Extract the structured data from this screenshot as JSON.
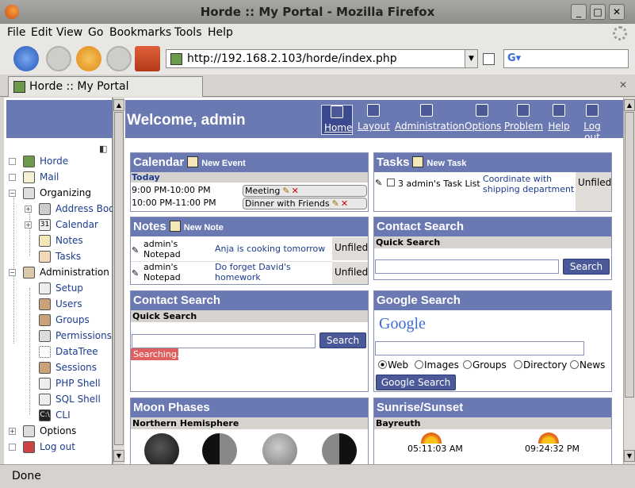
{
  "window": {
    "title": "Horde :: My Portal - Mozilla Firefox"
  },
  "menu": [
    "File",
    "Edit",
    "View",
    "Go",
    "Bookmarks",
    "Tools",
    "Help"
  ],
  "nav": {
    "url": "http://192.168.2.103/horde/index.php"
  },
  "tab": {
    "label": "Horde :: My Portal"
  },
  "sidebar": {
    "items": [
      {
        "label": "Horde",
        "icon": "horde-icon"
      },
      {
        "label": "Mail",
        "icon": "mail-icon"
      },
      {
        "label": "Organizing",
        "icon": "organizing-icon"
      },
      {
        "label": "Address Book",
        "icon": "address-book-icon"
      },
      {
        "label": "Calendar",
        "icon": "calendar-icon"
      },
      {
        "label": "Notes",
        "icon": "notes-icon"
      },
      {
        "label": "Tasks",
        "icon": "tasks-icon"
      },
      {
        "label": "Administration",
        "icon": "administration-icon"
      },
      {
        "label": "Setup",
        "icon": "setup-icon"
      },
      {
        "label": "Users",
        "icon": "users-icon"
      },
      {
        "label": "Groups",
        "icon": "groups-icon"
      },
      {
        "label": "Permissions",
        "icon": "permissions-icon"
      },
      {
        "label": "DataTree",
        "icon": "datatree-icon"
      },
      {
        "label": "Sessions",
        "icon": "sessions-icon"
      },
      {
        "label": "PHP Shell",
        "icon": "php-shell-icon"
      },
      {
        "label": "SQL Shell",
        "icon": "sql-shell-icon"
      },
      {
        "label": "CLI",
        "icon": "cli-icon"
      },
      {
        "label": "Options",
        "icon": "options-icon"
      },
      {
        "label": "Log out",
        "icon": "logout-icon"
      }
    ]
  },
  "header": {
    "welcome": "Welcome, admin",
    "nav": [
      {
        "label": "Home",
        "icon": "home-icon"
      },
      {
        "label": "Layout",
        "icon": "layout-icon"
      },
      {
        "label": "Administration",
        "icon": "administration-icon"
      },
      {
        "label": "Options",
        "icon": "options-icon"
      },
      {
        "label": "Problem",
        "icon": "problem-icon"
      },
      {
        "label": "Help",
        "icon": "help-icon"
      },
      {
        "label": "Log out",
        "icon": "logout-icon"
      }
    ]
  },
  "calendar": {
    "title": "Calendar",
    "action": "New Event",
    "day": "Today",
    "events": [
      {
        "time": "9:00 PM-10:00 PM",
        "name": "Meeting"
      },
      {
        "time": "10:00 PM-11:00 PM",
        "name": "Dinner with Friends"
      }
    ]
  },
  "tasks": {
    "title": "Tasks",
    "action": "New Task",
    "list": "3 admin's Task List",
    "task": "Coordinate with shipping department",
    "status": "Unfiled"
  },
  "notes": {
    "title": "Notes",
    "action": "New Note",
    "items": [
      {
        "notepad": "admin's Notepad",
        "note": "Anja is cooking tomorrow",
        "status": "Unfiled"
      },
      {
        "notepad": "admin's Notepad",
        "note": "Do forget David's homework",
        "status": "Unfiled"
      }
    ]
  },
  "contact_search_right": {
    "title": "Contact Search",
    "subtitle": "Quick Search",
    "button": "Search"
  },
  "contact_search_left": {
    "title": "Contact Search",
    "subtitle": "Quick Search",
    "button": "Search",
    "status": "Searching..."
  },
  "google_search": {
    "title": "Google Search",
    "logo": "Google",
    "options": [
      "Web",
      "Images",
      "Groups",
      "Directory",
      "News"
    ],
    "button": "Google Search"
  },
  "moon": {
    "title": "Moon Phases",
    "subtitle": "Northern Hemisphere"
  },
  "sun": {
    "title": "Sunrise/Sunset",
    "location": "Bayreuth",
    "sunrise": "05:11:03 AM",
    "sunset": "09:24:32 PM"
  },
  "status": "Done"
}
